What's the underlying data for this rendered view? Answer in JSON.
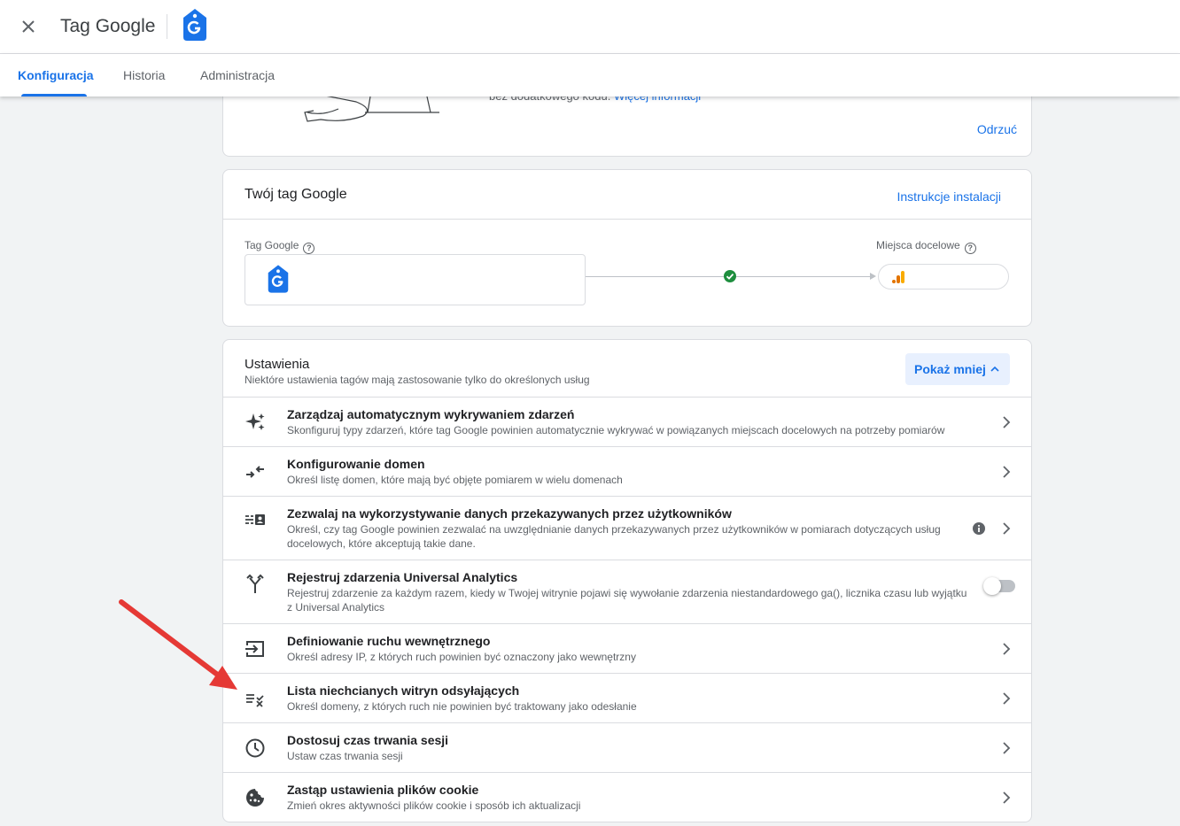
{
  "header": {
    "title": "Tag Google"
  },
  "tabs": [
    "Konfiguracja",
    "Historia",
    "Administracja"
  ],
  "promo": {
    "text": "bez dodatkowego kodu.",
    "link": "Więcej informacji",
    "dismiss": "Odrzuć"
  },
  "tag_card": {
    "title": "Twój tag Google",
    "install_link": "Instrukcje instalacji",
    "tag_label": "Tag Google",
    "dest_label": "Miejsca docelowe"
  },
  "settings": {
    "title": "Ustawienia",
    "subtitle": "Niektóre ustawienia tagów mają zastosowanie tylko do określonych usług",
    "toggle_button": "Pokaż mniej",
    "items": [
      {
        "title": "Zarządzaj automatycznym wykrywaniem zdarzeń",
        "desc": "Skonfiguruj typy zdarzeń, które tag Google powinien automatycznie wykrywać w powiązanych miejscach docelowych na potrzeby pomiarów",
        "icon": "sparkle-icon"
      },
      {
        "title": "Konfigurowanie domen",
        "desc": "Określ listę domen, które mają być objęte pomiarem w wielu domenach",
        "icon": "merge-arrows-icon"
      },
      {
        "title": "Zezwalaj na wykorzystywanie danych przekazywanych przez użytkowników",
        "desc": "Określ, czy tag Google powinien zezwalać na uwzględnianie danych przekazywanych przez użytkowników w pomiarach dotyczących usług docelowych, które akceptują takie dane.",
        "icon": "user-data-icon"
      },
      {
        "title": "Rejestruj zdarzenia Universal Analytics",
        "desc": "Rejestruj zdarzenie za każdym razem, kiedy w Twojej witrynie pojawi się wywołanie zdarzenia niestandardowego ga(), licznika czasu lub wyjątku z Universal Analytics",
        "icon": "fork-icon",
        "toggle_on": false
      },
      {
        "title": "Definiowanie ruchu wewnętrznego",
        "desc": "Określ adresy IP, z których ruch powinien być oznaczony jako wewnętrzny",
        "icon": "login-icon"
      },
      {
        "title": "Lista niechcianych witryn odsyłających",
        "desc": "Określ domeny, z których ruch nie powinien być traktowany jako odesłanie",
        "icon": "list-remove-icon"
      },
      {
        "title": "Dostosuj czas trwania sesji",
        "desc": "Ustaw czas trwania sesji",
        "icon": "clock-icon"
      },
      {
        "title": "Zastąp ustawienia plików cookie",
        "desc": "Zmień okres aktywności plików cookie i sposób ich aktualizacji",
        "icon": "cookie-icon"
      }
    ]
  },
  "colors": {
    "accent": "#1a73e8",
    "arrow": "#e53935",
    "success": "#1e8e3e"
  }
}
